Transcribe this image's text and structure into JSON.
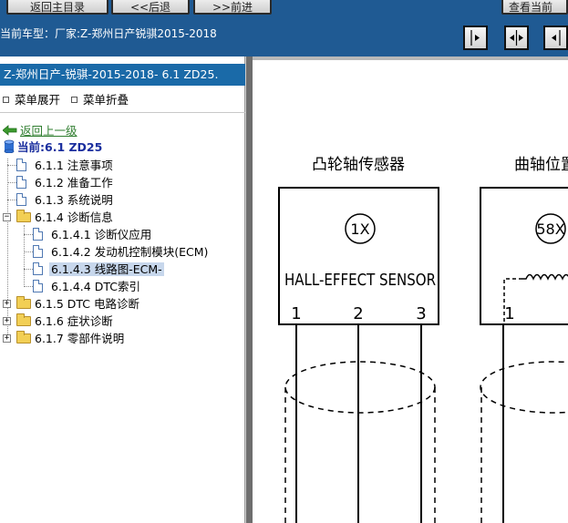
{
  "toolbar": {
    "home_label": "返回主目录",
    "back_label": "<<后退",
    "forward_label": ">>前进",
    "view_label": "查看当前",
    "model_label": "当前车型：厂家:Z-郑州日产锐骐2015-2018"
  },
  "tree": {
    "header": "Z-郑州日产-锐骐-2015-2018- 6.1 ZD25.",
    "expand_label": "菜单展开",
    "collapse_label": "菜单折叠",
    "back_link": "返回上一级",
    "current": "当前:6.1 ZD25",
    "items": [
      {
        "label": "6.1.1 注意事项"
      },
      {
        "label": "6.1.2 准备工作"
      },
      {
        "label": "6.1.3 系统说明"
      },
      {
        "label": "6.1.4 诊断信息"
      },
      {
        "label": "6.1.4.1 诊断仪应用"
      },
      {
        "label": "6.1.4.2 发动机控制模块(ECM)"
      },
      {
        "label": "6.1.4.3 线路图-ECM-"
      },
      {
        "label": "6.1.4.4 DTC索引"
      },
      {
        "label": "6.1.5 DTC 电路诊断"
      },
      {
        "label": "6.1.6 症状诊断"
      },
      {
        "label": "6.1.7 零部件说明"
      }
    ]
  },
  "diagram": {
    "cam_title": "凸轮轴传感器",
    "cam_id": "1X",
    "cam_type": "HALL-EFFECT SENSOR",
    "cam_pins": [
      "1",
      "2",
      "3"
    ],
    "crank_title": "曲轴位置",
    "crank_id": "58X",
    "crank_pin": "1"
  }
}
